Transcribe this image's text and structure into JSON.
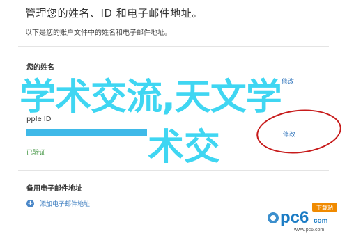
{
  "header": {
    "title": "管理您的姓名、ID 和电子邮件地址。",
    "subtitle": "以下是您的账户文件中的姓名和电子邮件地址。"
  },
  "name_section": {
    "label": "您的姓名",
    "edit_label": "修改"
  },
  "apple_id_section": {
    "label": "Apple ID",
    "label_visible_part": "pple ID",
    "edit_label": "修改",
    "verified_label": "已验证"
  },
  "backup_section": {
    "label": "备用电子邮件地址",
    "add_label": "添加电子邮件地址",
    "add_icon_glyph": "+"
  },
  "watermark": {
    "line1": "学术交流,天文学",
    "line2": "术交"
  },
  "logo": {
    "brand": "pc6",
    "brand_suffix": "com",
    "badge": "下载站",
    "site": "www.pc6.com"
  },
  "colors": {
    "link": "#3a7bbf",
    "verified": "#2e8a2e",
    "watermark": "#3fd6f2",
    "redaction": "#3fb9e8",
    "annotation": "#c71b1b",
    "brand": "#1a7bc4",
    "badge": "#f08a00"
  }
}
